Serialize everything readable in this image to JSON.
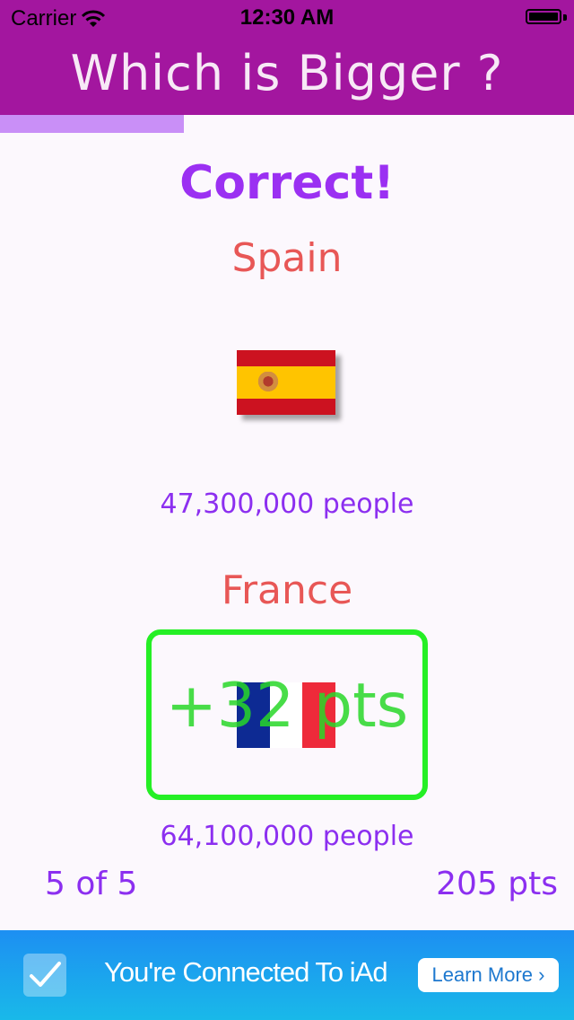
{
  "status_bar": {
    "carrier": "Carrier",
    "time": "12:30 AM"
  },
  "header": {
    "title": "Which is Bigger ?"
  },
  "progress": {
    "fraction": 0.32,
    "color": "#c98ff7"
  },
  "quiz": {
    "result": "Correct!",
    "country_a": {
      "name": "Spain",
      "population": "47,300,000 people",
      "flag": "spain-flag"
    },
    "country_b": {
      "name": "France",
      "population": "64,100,000 people",
      "flag": "france-flag",
      "points_awarded": "+32 pts"
    },
    "question_counter": "5 of 5",
    "score": "205 pts"
  },
  "ad": {
    "text": "You're Connected To iAd",
    "button_label": "Learn More ›"
  },
  "colors": {
    "brand": "#a3169f",
    "accent": "#9b30f2",
    "country_name": "#e85756",
    "highlight_green": "#25ef25"
  }
}
